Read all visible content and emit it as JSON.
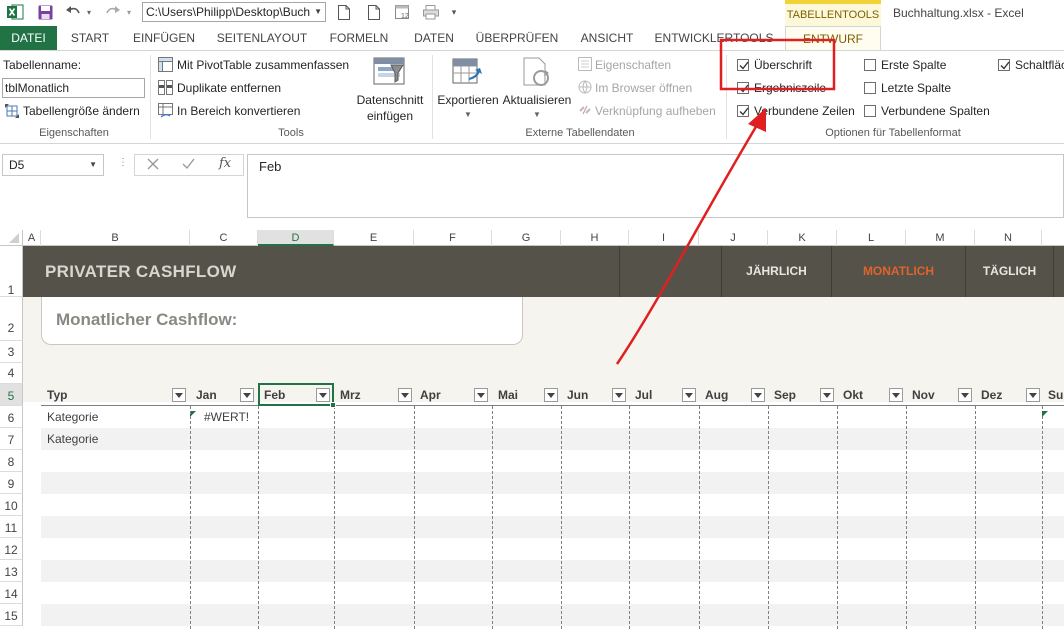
{
  "qat": {
    "path": "C:\\Users\\Philipp\\Desktop\\Buch",
    "icons": [
      "excel-logo-icon",
      "save-icon",
      "undo-icon",
      "redo-icon",
      "new-file-icon",
      "open-file-icon",
      "calendar-icon",
      "print-preview-icon",
      "customize-icon"
    ]
  },
  "context_tab": "TABELLENTOOLS",
  "window_title": "Buchhaltung.xlsx - Excel",
  "tabs": [
    {
      "label": "DATEI"
    },
    {
      "label": "START"
    },
    {
      "label": "EINFÜGEN"
    },
    {
      "label": "SEITENLAYOUT"
    },
    {
      "label": "FORMELN"
    },
    {
      "label": "DATEN"
    },
    {
      "label": "ÜBERPRÜFEN"
    },
    {
      "label": "ANSICHT"
    },
    {
      "label": "ENTWICKLERTOOLS"
    },
    {
      "label": "ENTWURF"
    }
  ],
  "ribbon": {
    "properties": {
      "tablename_label": "Tabellenname:",
      "tablename_value": "tblMonatlich",
      "resize_label": "Tabellengröße ändern",
      "group": "Eigenschaften"
    },
    "tools": {
      "pivot": "Mit PivotTable zusammenfassen",
      "duplicates": "Duplikate entfernen",
      "convert": "In Bereich konvertieren",
      "slicer_line1": "Datenschnitt",
      "slicer_line2": "einfügen",
      "group": "Tools"
    },
    "external": {
      "export": "Exportieren",
      "refresh": "Aktualisieren",
      "properties": "Eigenschaften",
      "browser": "Im Browser öffnen",
      "unlink": "Verknüpfung aufheben",
      "group": "Externe Tabellendaten"
    },
    "options": {
      "header_row": "Überschrift",
      "total_row": "Ergebniszeile",
      "banded_rows": "Verbundene Zeilen",
      "first_col": "Erste Spalte",
      "last_col": "Letzte Spalte",
      "banded_cols": "Verbundene Spalten",
      "filter_button": "Schaltfläche",
      "group": "Optionen für Tabellenformat",
      "header_row_checked": true,
      "total_row_checked": true,
      "banded_rows_checked": true,
      "first_col_checked": false,
      "last_col_checked": false,
      "banded_cols_checked": false,
      "filter_button_checked": true
    }
  },
  "formula_bar": {
    "namebox": "D5",
    "formula": "Feb"
  },
  "columns": [
    "A",
    "B",
    "C",
    "D",
    "E",
    "F",
    "G",
    "H",
    "I",
    "J",
    "K",
    "L",
    "M",
    "N"
  ],
  "rows": [
    "1",
    "2",
    "3",
    "4",
    "5",
    "6",
    "7",
    "8",
    "9",
    "10",
    "11",
    "12",
    "13",
    "14",
    "15"
  ],
  "sheet": {
    "banner_title": "PRIVATER CASHFLOW",
    "nav": [
      "JÄHRLICH",
      "MONATLICH",
      "TÄGLICH"
    ],
    "subtitle": "Monatlicher Cashflow:",
    "headers": [
      "Typ",
      "Jan",
      "Feb",
      "Mrz",
      "Apr",
      "Mai",
      "Jun",
      "Jul",
      "Aug",
      "Sep",
      "Okt",
      "Nov",
      "Dez",
      "Su"
    ],
    "row6": {
      "type": "Kategorie",
      "jan": "#WERT!"
    },
    "row7": {
      "type": "Kategorie"
    }
  },
  "colors": {
    "excel_green": "#217346",
    "banner": "#545249",
    "nav_active": "#e0642a",
    "annotation_red": "#e02020"
  }
}
